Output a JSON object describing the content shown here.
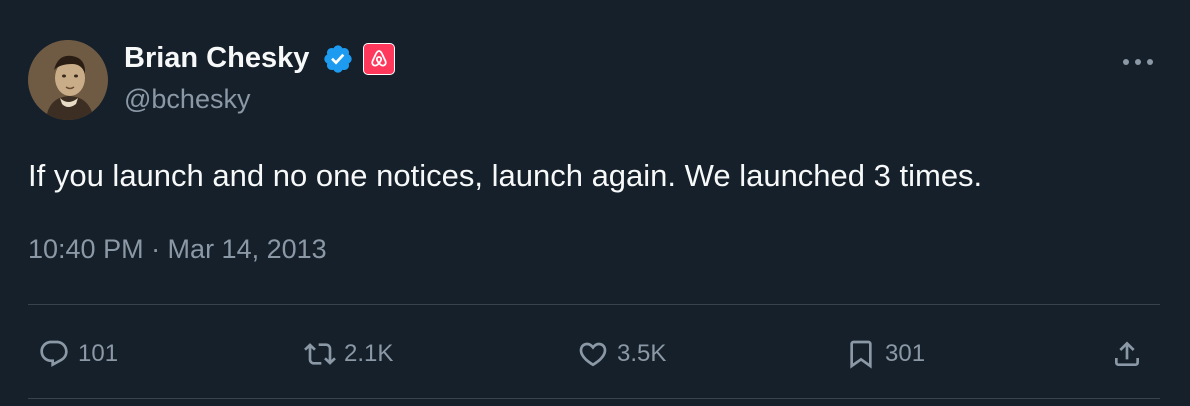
{
  "author": {
    "name": "Brian Chesky",
    "handle": "@bchesky"
  },
  "tweet": {
    "text": "If you launch and no one notices, launch again. We launched 3 times.",
    "timestamp": "10:40 PM · Mar 14, 2013"
  },
  "actions": {
    "reply_count": "101",
    "retweet_count": "2.1K",
    "like_count": "3.5K",
    "bookmark_count": "301"
  },
  "icons": {
    "verified": "verified-badge-icon",
    "affiliate": "airbnb-logo-icon",
    "more": "more-dots-icon",
    "reply": "reply-icon",
    "retweet": "retweet-icon",
    "like": "heart-icon",
    "bookmark": "bookmark-icon",
    "share": "share-icon"
  },
  "colors": {
    "background": "#15202b",
    "text_primary": "#f7f9f9",
    "text_secondary": "#8b98a5",
    "verified_blue": "#1d9bf0",
    "airbnb_red": "#ff385c",
    "divider": "#38444d"
  }
}
